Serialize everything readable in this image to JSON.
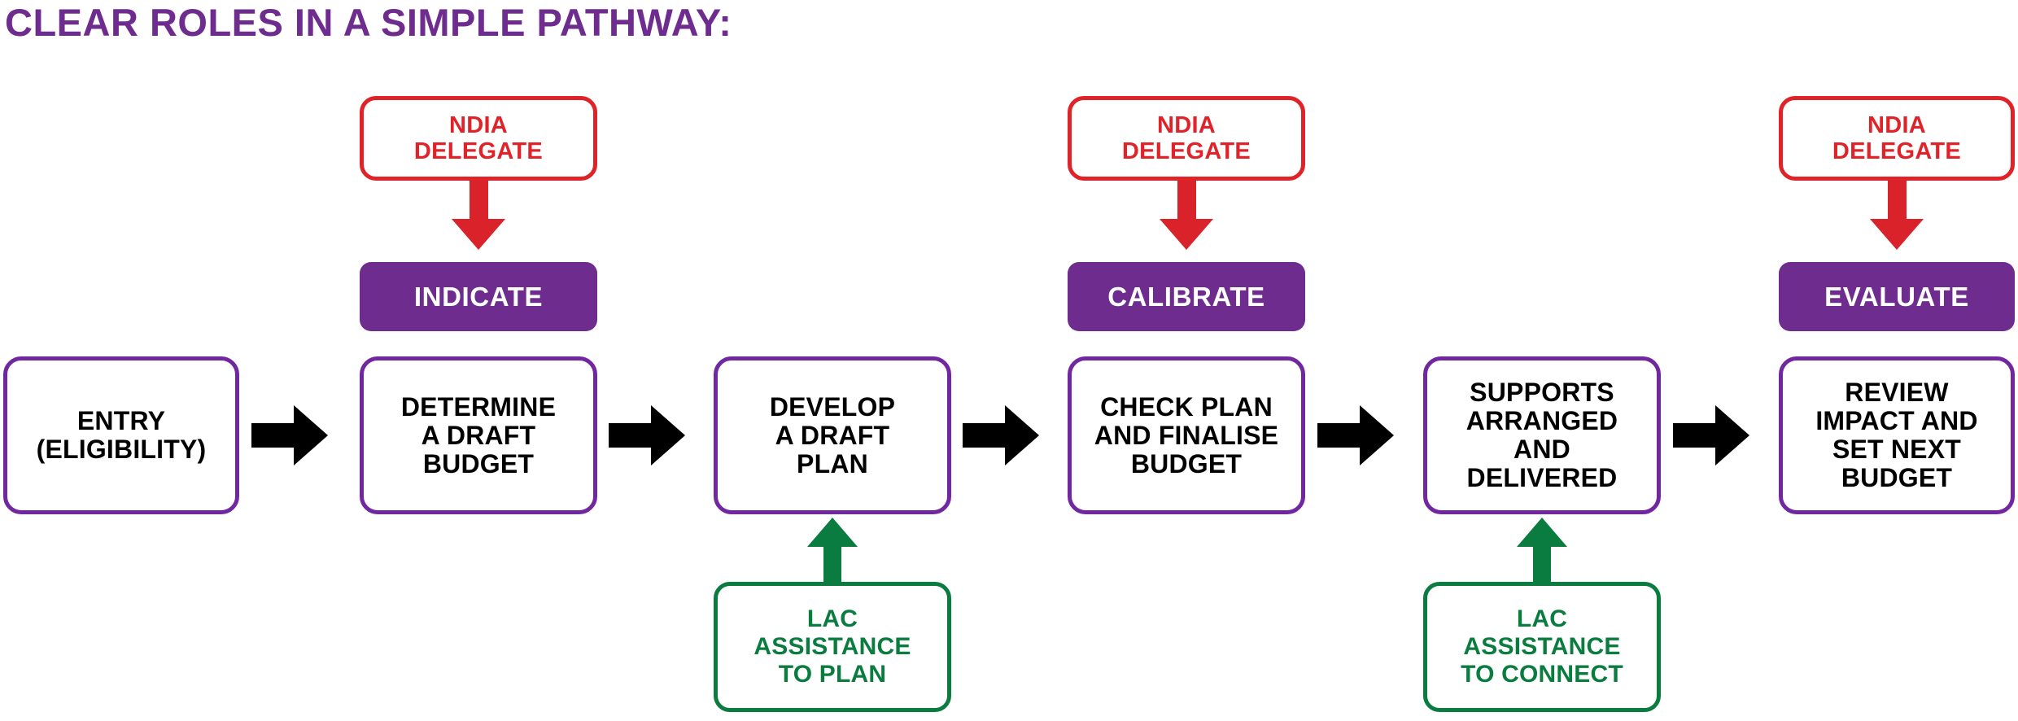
{
  "title": "CLEAR ROLES IN A SIMPLE PATHWAY:",
  "colors": {
    "purple": "#6E2C8F",
    "purple_outline": "#7127A0",
    "red": "#E02229",
    "red_arrow": "#D92229",
    "green": "#0B7C3F",
    "black": "#000000",
    "background": "#FFFFFF"
  },
  "pathway": {
    "steps": [
      {
        "id": "entry",
        "line1": "ENTRY",
        "line2": "(ELIGIBILITY)",
        "line3": "",
        "line4": ""
      },
      {
        "id": "determine-draft-budget",
        "line1": "DETERMINE",
        "line2": "A DRAFT",
        "line3": "BUDGET",
        "line4": ""
      },
      {
        "id": "develop-draft-plan",
        "line1": "DEVELOP",
        "line2": "A DRAFT",
        "line3": "PLAN",
        "line4": ""
      },
      {
        "id": "check-finalise-budget",
        "line1": "CHECK PLAN",
        "line2": "AND FINALISE",
        "line3": "BUDGET",
        "line4": ""
      },
      {
        "id": "supports-delivered",
        "line1": "SUPPORTS",
        "line2": "ARRANGED",
        "line3": "AND",
        "line4": "DELIVERED"
      },
      {
        "id": "review-set-next-budget",
        "line1": "REVIEW",
        "line2": "IMPACT AND",
        "line3": "SET NEXT",
        "line4": "BUDGET"
      }
    ]
  },
  "delegates": [
    {
      "id": "delegate-1",
      "line1": "NDIA",
      "line2": "DELEGATE",
      "action": "INDICATE"
    },
    {
      "id": "delegate-2",
      "line1": "NDIA",
      "line2": "DELEGATE",
      "action": "CALIBRATE"
    },
    {
      "id": "delegate-3",
      "line1": "NDIA",
      "line2": "DELEGATE",
      "action": "EVALUATE"
    }
  ],
  "lac": [
    {
      "id": "lac-plan",
      "line1": "LAC",
      "line2": "ASSISTANCE",
      "line3": "TO PLAN"
    },
    {
      "id": "lac-connect",
      "line1": "LAC",
      "line2": "ASSISTANCE",
      "line3": "TO CONNECT"
    }
  ],
  "arrows": {
    "flow_icon": "arrow-right-icon",
    "delegate_icon": "arrow-down-icon",
    "lac_icon": "arrow-up-icon"
  }
}
